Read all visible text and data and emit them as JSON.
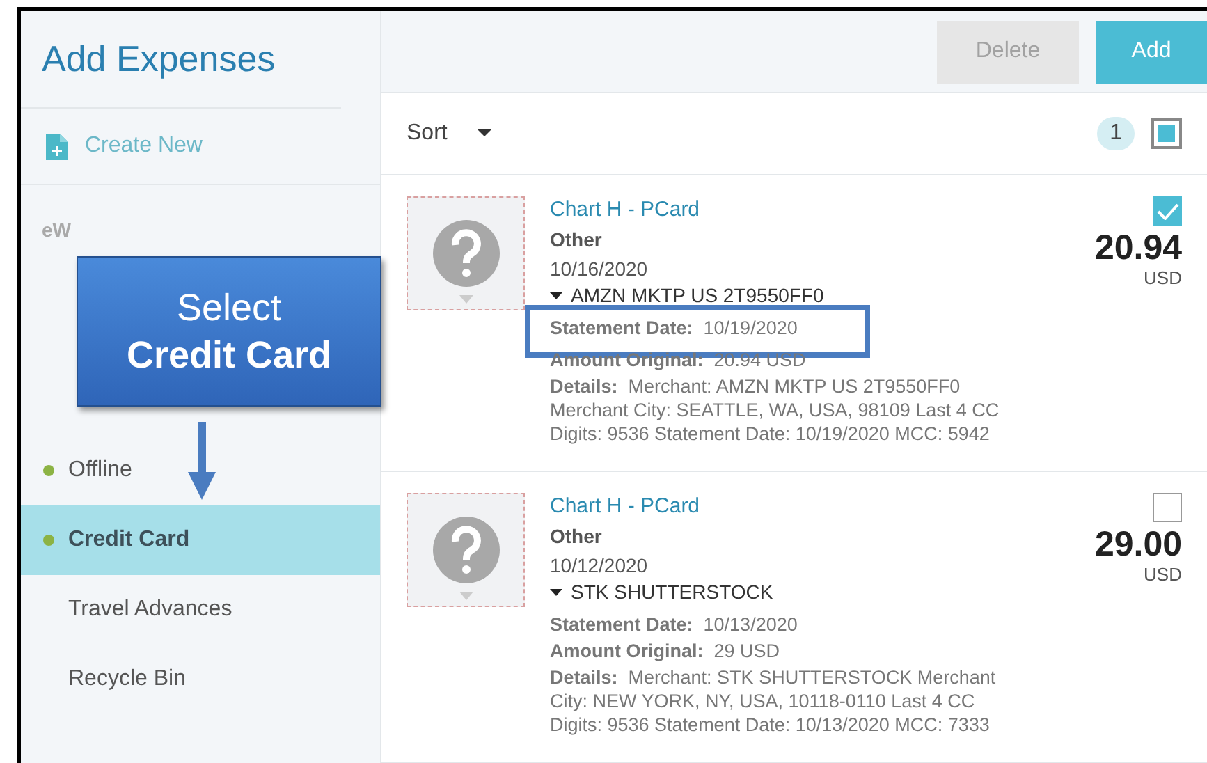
{
  "sidebar": {
    "title": "Add Expenses",
    "create_new": "Create New",
    "section_label": "eW",
    "items": [
      {
        "label": "Offline",
        "dot": true,
        "selected": false
      },
      {
        "label": "Credit Card",
        "dot": true,
        "selected": true
      },
      {
        "label": "Travel Advances",
        "dot": false,
        "selected": false
      },
      {
        "label": "Recycle Bin",
        "dot": false,
        "selected": false
      }
    ]
  },
  "toolbar": {
    "buttons": [
      {
        "label": "Delete",
        "disabled": true
      },
      {
        "label": "Add",
        "disabled": false
      }
    ]
  },
  "list_header": {
    "sort_label": "Sort",
    "count": "1",
    "select_all_indeterminate": true
  },
  "expenses": [
    {
      "title": "Chart H - PCard",
      "category": "Other",
      "date": "10/16/2020",
      "merchant": "AMZN MKTP US 2T9550FF0",
      "checked": true,
      "amount": "20.94",
      "currency": "USD",
      "fields": [
        {
          "label": "Statement Date:",
          "value": "10/19/2020",
          "highlighted": true
        },
        {
          "label": "Amount Original:",
          "value": "20.94 USD",
          "highlighted": false
        },
        {
          "label": "Details:",
          "value": "Merchant: AMZN MKTP US 2T9550FF0 Merchant City: SEATTLE, WA, USA, 98109 Last 4 CC Digits: 9536 Statement Date: 10/19/2020 MCC: 5942",
          "highlighted": false
        }
      ]
    },
    {
      "title": "Chart H - PCard",
      "category": "Other",
      "date": "10/12/2020",
      "merchant": "STK SHUTTERSTOCK",
      "checked": false,
      "amount": "29.00",
      "currency": "USD",
      "fields": [
        {
          "label": "Statement Date:",
          "value": "10/13/2020",
          "highlighted": false
        },
        {
          "label": "Amount Original:",
          "value": "29 USD",
          "highlighted": false
        },
        {
          "label": "Details:",
          "value": "Merchant: STK SHUTTERSTOCK Merchant City: NEW YORK, NY, USA, 10118-0110 Last 4 CC Digits: 9536 Statement Date: 10/13/2020 MCC: 7333",
          "highlighted": false
        }
      ]
    }
  ],
  "callout": {
    "line1": "Select",
    "line2": "Credit Card"
  }
}
